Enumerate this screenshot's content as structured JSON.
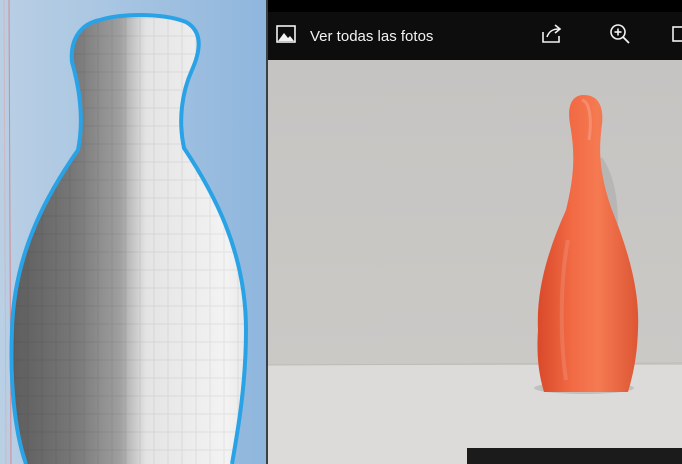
{
  "viewer": {
    "toolbar": {
      "see_all_label": "Ver todas las fotos",
      "icons": [
        "photos-icon",
        "share-icon",
        "zoom-in-icon",
        "more-icon"
      ]
    }
  },
  "viewport": {
    "outline_color": "#29a3e6",
    "background_color": "#9fc0e1"
  },
  "photo": {
    "pin_color": "#e8603e"
  }
}
